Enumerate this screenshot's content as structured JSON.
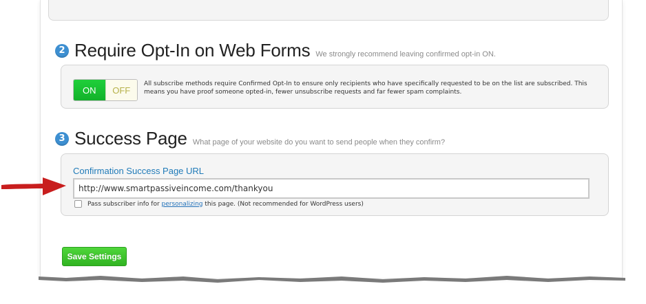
{
  "section_require_optin": {
    "number": "2",
    "title": "Require Opt-In on Web Forms",
    "subtitle": "We strongly recommend leaving confirmed opt-in ON.",
    "toggle": {
      "on_label": "ON",
      "off_label": "OFF",
      "state": "on"
    },
    "description": "All subscribe methods require Confirmed Opt-In to ensure only recipients who have specifically requested to be on the list are subscribed. This means you have proof someone opted-in, fewer unsubscribe requests and far fewer spam complaints."
  },
  "section_success_page": {
    "number": "3",
    "title": "Success Page",
    "subtitle": "What page of your website do you want to send people when they confirm?",
    "field_label": "Confirmation Success Page URL",
    "url_value": "http://www.smartpassiveincome.com/thankyou",
    "checkbox": {
      "checked": false,
      "text_before": "Pass subscriber info for ",
      "link_text": "personalizing",
      "text_after": " this page. (Not recommended for WordPress users)"
    }
  },
  "save_button_label": "Save Settings",
  "colors": {
    "accent_blue": "#3d8fd1",
    "toggle_on_green": "#12b22a",
    "save_green": "#31b422",
    "annotation_red": "#c81e1e"
  }
}
